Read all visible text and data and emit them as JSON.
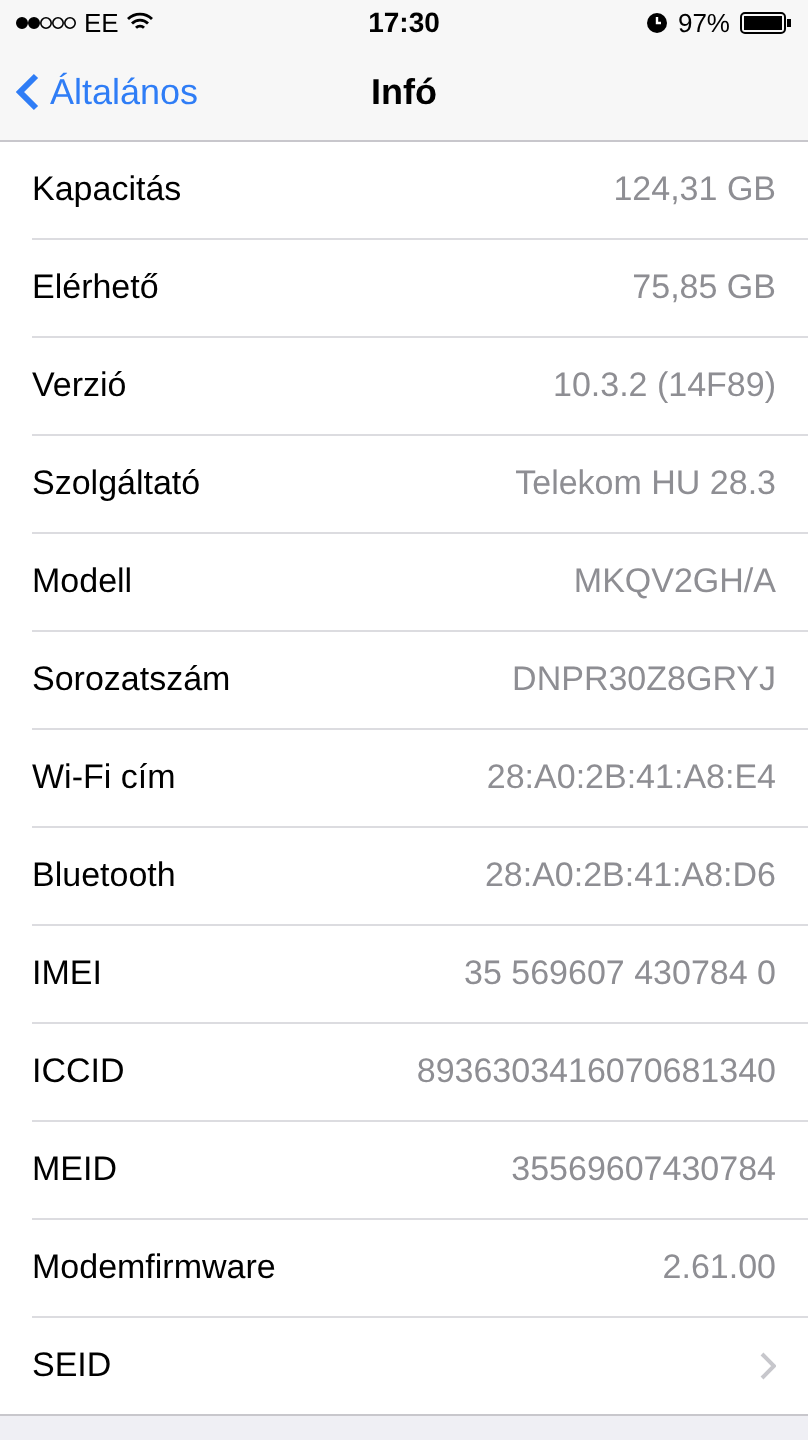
{
  "status_bar": {
    "carrier": "EE",
    "time": "17:30",
    "battery": "97%"
  },
  "nav": {
    "back": "Általános",
    "title": "Infó"
  },
  "rows": [
    {
      "kind": "value",
      "label": "Kapacitás",
      "value": "124,31 GB"
    },
    {
      "kind": "value",
      "label": "Elérhető",
      "value": "75,85 GB"
    },
    {
      "kind": "value",
      "label": "Verzió",
      "value": "10.3.2 (14F89)"
    },
    {
      "kind": "value",
      "label": "Szolgáltató",
      "value": "Telekom HU 28.3"
    },
    {
      "kind": "value",
      "label": "Modell",
      "value": "MKQV2GH/A"
    },
    {
      "kind": "value",
      "label": "Sorozatszám",
      "value": "DNPR30Z8GRYJ"
    },
    {
      "kind": "value",
      "label": "Wi-Fi cím",
      "value": "28:A0:2B:41:A8:E4"
    },
    {
      "kind": "value",
      "label": "Bluetooth",
      "value": "28:A0:2B:41:A8:D6"
    },
    {
      "kind": "value",
      "label": "IMEI",
      "value": "35 569607 430784 0"
    },
    {
      "kind": "value",
      "label": "ICCID",
      "value": "8936303416070681340"
    },
    {
      "kind": "value",
      "label": "MEID",
      "value": "35569607430784"
    },
    {
      "kind": "value",
      "label": "Modemfirmware",
      "value": "2.61.00"
    },
    {
      "kind": "disclosure",
      "label": "SEID"
    }
  ]
}
